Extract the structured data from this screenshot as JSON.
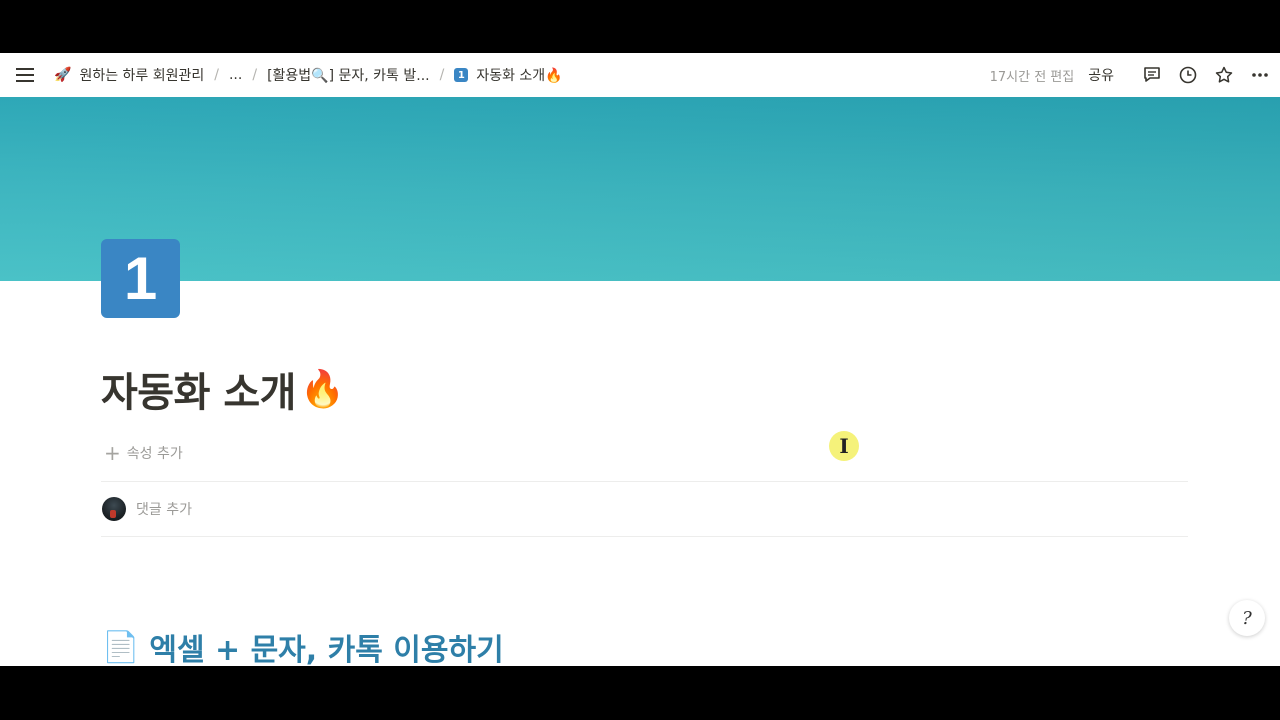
{
  "topbar": {
    "breadcrumbs": [
      {
        "emoji": "🚀",
        "label": "원하는 하루 회원관리"
      },
      {
        "label": "..."
      },
      {
        "label": "[활용법🔍] 문자, 카톡 발..."
      },
      {
        "badge": "1",
        "label": "자동화 소개🔥"
      }
    ],
    "separator": "/",
    "edited": "17시간 전 편집",
    "share": "공유",
    "icons": [
      "menu-icon",
      "comment-icon",
      "clock-icon",
      "star-icon",
      "more-icon"
    ]
  },
  "page": {
    "icon_text": "1",
    "icon_color": "#3a86c4",
    "cover_colors": [
      "#2aa6b6",
      "#47c1c6"
    ],
    "title": "자동화 소개",
    "title_emoji": "🔥",
    "add_property": "속성 추가",
    "add_comment": "댓글 추가",
    "section_emoji": "📄",
    "section_heading": "엑셀 + 문자, 카톡 이용하기",
    "heading_color": "#2e7fa8"
  },
  "cursor": {
    "glyph": "I"
  },
  "help": {
    "glyph": "?"
  }
}
